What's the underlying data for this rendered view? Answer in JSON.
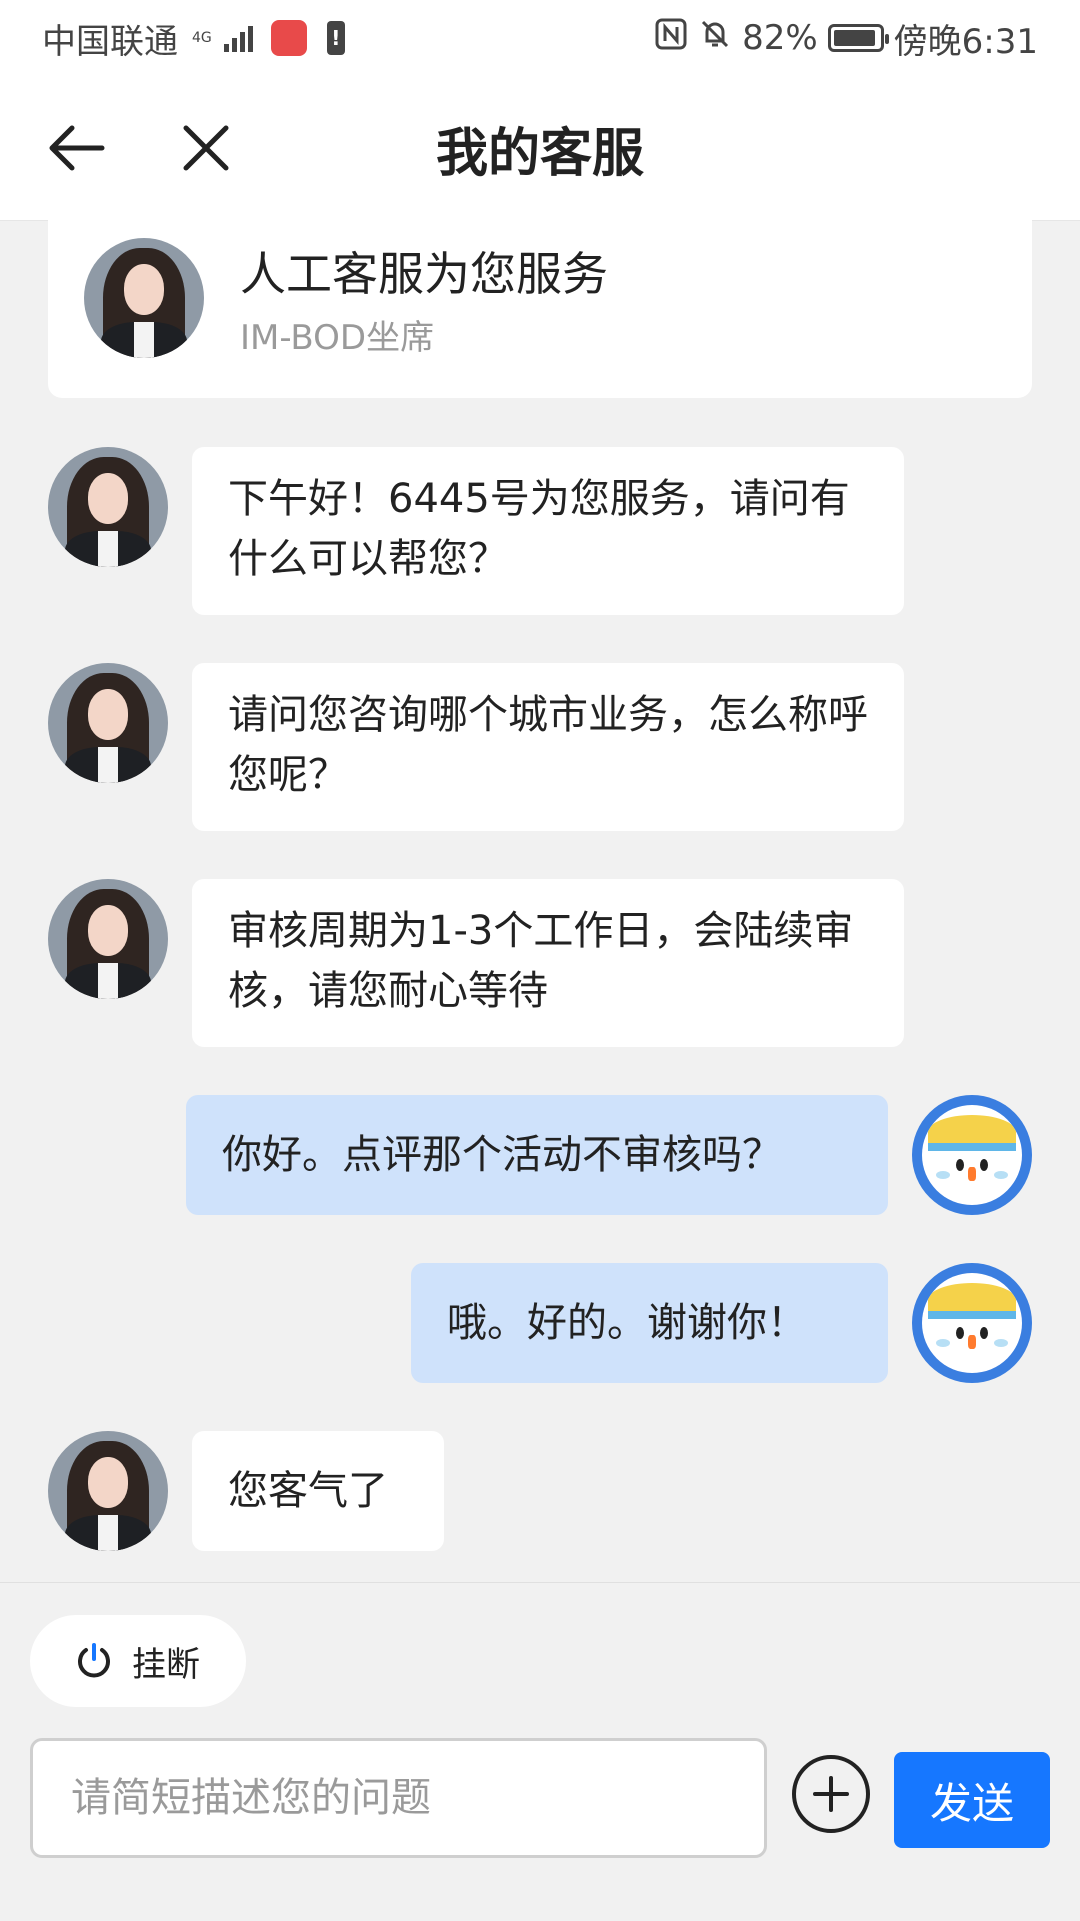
{
  "status_bar": {
    "carrier": "中国联通",
    "network": "4G",
    "battery_percent": "82%",
    "time": "傍晚6:31"
  },
  "header": {
    "title": "我的客服",
    "back_icon": "arrow-left-icon",
    "close_icon": "close-icon"
  },
  "agent_card": {
    "title": "人工客服为您服务",
    "subtitle": "IM-BOD坐席"
  },
  "messages": [
    {
      "from": "agent",
      "text": "下午好！6445号为您服务，请问有什么可以帮您？"
    },
    {
      "from": "agent",
      "text": "请问您咨询哪个城市业务，怎么称呼您呢？"
    },
    {
      "from": "agent",
      "text": "审核周期为1-3个工作日，会陆续审核，请您耐心等待"
    },
    {
      "from": "user",
      "text": "你好。点评那个活动不审核吗？"
    },
    {
      "from": "user",
      "text": "哦。好的。谢谢你！"
    },
    {
      "from": "agent",
      "text": "您客气了"
    }
  ],
  "bottom": {
    "hangup_label": "挂断",
    "input_placeholder": "请简短描述您的问题",
    "send_label": "发送"
  },
  "colors": {
    "accent": "#1677ff",
    "user_bubble": "#cfe2fb",
    "background": "#f1f1f1"
  }
}
